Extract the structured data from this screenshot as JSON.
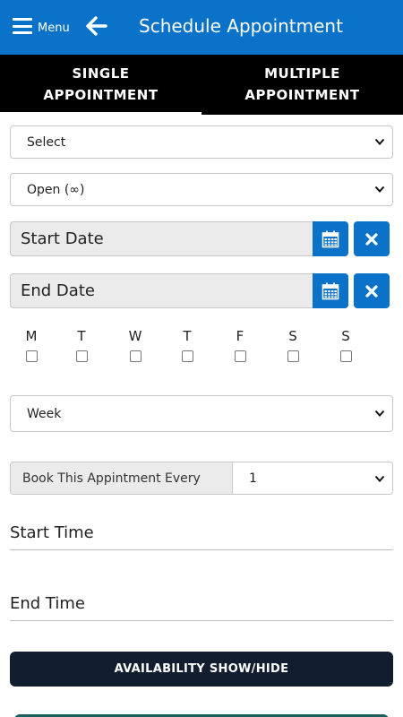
{
  "header": {
    "menu_label": "Menu",
    "title": "Schedule Appointment",
    "color": "#0a72c8"
  },
  "tabs": [
    {
      "line1": "SINGLE",
      "line2": "APPOINTMENT",
      "active": true
    },
    {
      "line1": "MULTIPLE",
      "line2": "APPOINTMENT",
      "active": false
    }
  ],
  "form": {
    "select1": "Select",
    "select2": "Open (∞)",
    "start_date_placeholder": "Start Date",
    "end_date_placeholder": "End Date",
    "calendar_icon": "calendar-icon",
    "clear_icon": "close-icon",
    "days": [
      "M",
      "T",
      "W",
      "T",
      "F",
      "S",
      "S"
    ],
    "repeat_unit": "Week",
    "book_label": "Book This Appintment Every",
    "book_value": "1",
    "start_time_placeholder": "Start Time",
    "end_time_placeholder": "End Time"
  },
  "actions": {
    "availability_label": "AVAILABILITY SHOW/HIDE"
  }
}
